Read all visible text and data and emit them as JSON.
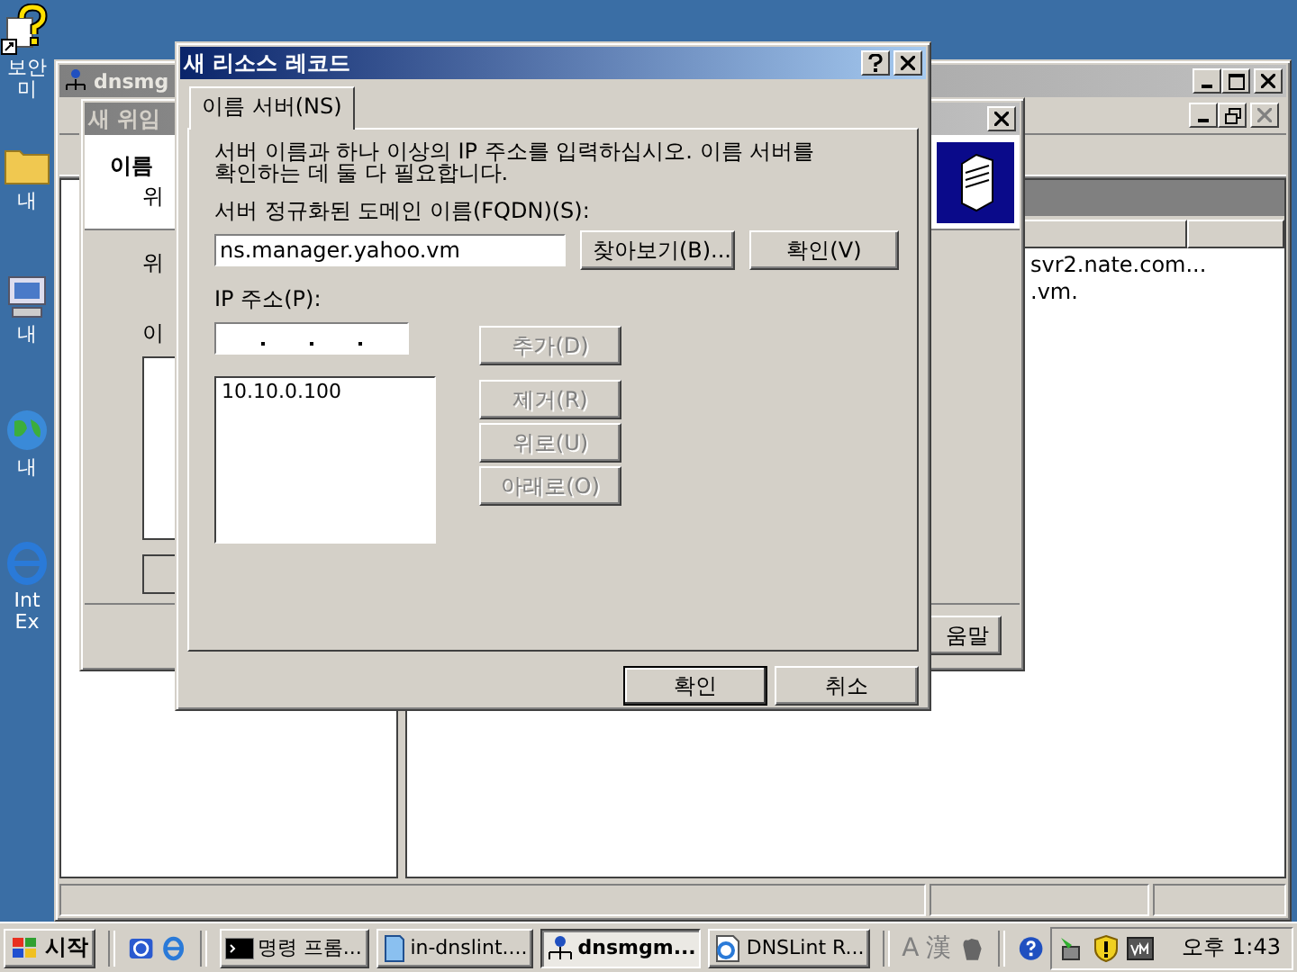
{
  "desktop_icons": [
    {
      "kind": "help-shortcut",
      "lines": [
        "보안",
        "미"
      ]
    },
    {
      "kind": "folder",
      "lines": [
        "내"
      ]
    },
    {
      "kind": "computer",
      "lines": [
        "내"
      ]
    },
    {
      "kind": "globe",
      "lines": [
        "내"
      ]
    },
    {
      "kind": "browser",
      "lines": [
        "Int",
        "Ex"
      ]
    }
  ],
  "mmc": {
    "title": "dnsmg",
    "list_rows": [
      "svr2.nate.com...",
      ".vm."
    ]
  },
  "wizard": {
    "title": "새 위임",
    "header_title": "이름",
    "header_subtitle": "위",
    "labels": [
      "위",
      "이"
    ],
    "help_button": "움말"
  },
  "dialog": {
    "title": "새 리소스 레코드",
    "tabs": [
      {
        "label": "이름 서버(NS)",
        "selected": true
      }
    ],
    "description": "서버 이름과 하나 이상의 IP 주소를 입력하십시오. 이름 서버를 확인하는 데 둘 다 필요합니다.",
    "fqdn_label": "서버 정규화된 도메인 이름(FQDN)(S):",
    "fqdn_value": "ns.manager.yahoo.vm",
    "fqdn_buttons": [
      {
        "label": "찾아보기(B)...",
        "disabled": false
      },
      {
        "label": "확인(V)",
        "disabled": false
      }
    ],
    "ip_label": "IP 주소(P):",
    "ip_buttons": [
      {
        "label": "추가(D)",
        "disabled": true
      },
      {
        "label": "제거(R)",
        "disabled": true
      },
      {
        "label": "위로(U)",
        "disabled": true
      },
      {
        "label": "아래로(O)",
        "disabled": true
      }
    ],
    "ip_list": [
      "10.10.0.100"
    ],
    "buttons": [
      {
        "label": "확인",
        "default": true
      },
      {
        "label": "취소",
        "default": false
      }
    ]
  },
  "taskbar": {
    "start": "시작",
    "tasks": [
      {
        "kind": "console",
        "label": "명령 프롬...",
        "selected": false
      },
      {
        "kind": "document",
        "label": "in-dnslint....",
        "selected": false
      },
      {
        "kind": "network",
        "label": "dnsmgm...",
        "selected": true
      },
      {
        "kind": "web",
        "label": "DNSLint R...",
        "selected": false
      }
    ],
    "ime": [
      "A",
      "漢"
    ],
    "clock": "오후 1:43"
  }
}
